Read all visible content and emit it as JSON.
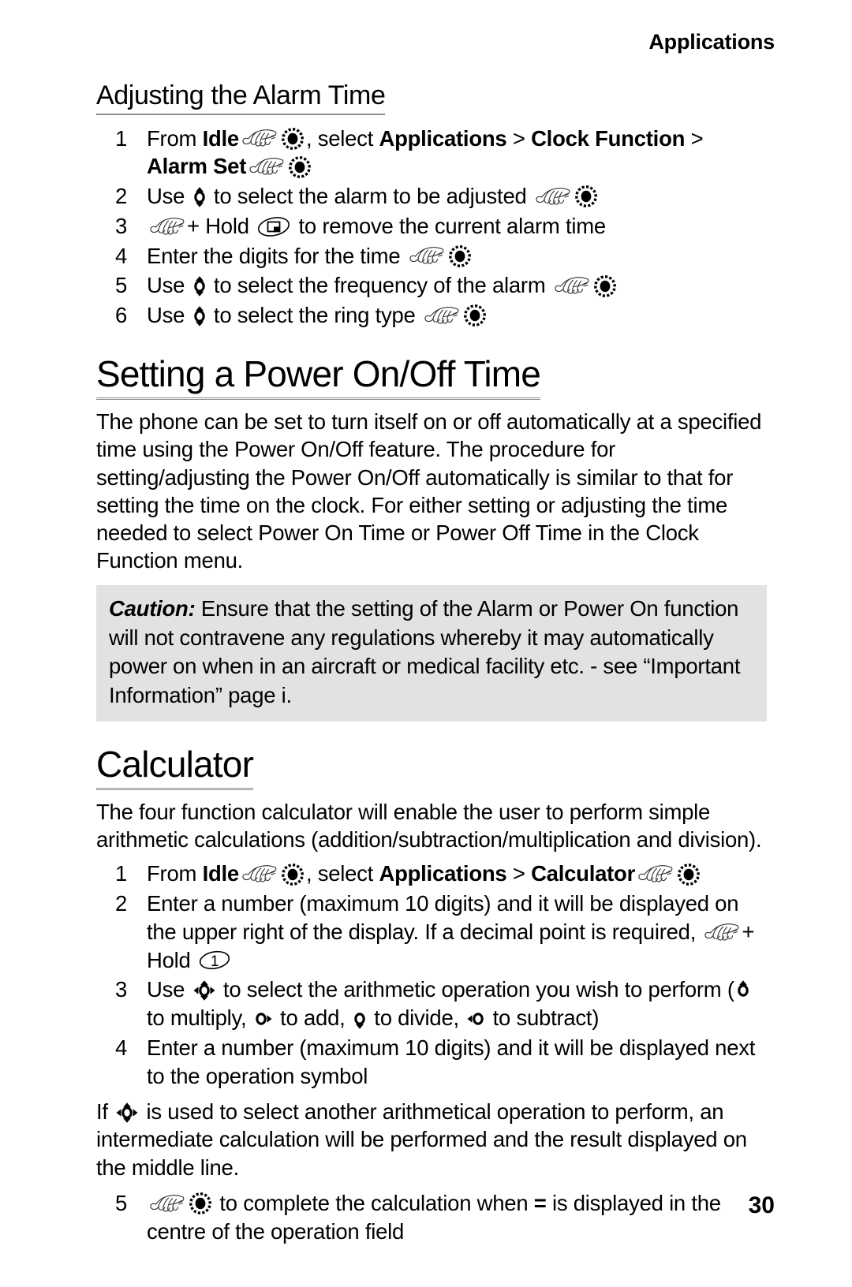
{
  "header": {
    "running_title": "Applications"
  },
  "page_number": "30",
  "colors": {
    "text": "#000000",
    "page_background": "#ffffff",
    "caution_background": "#e2e2e2",
    "heading_rule": "#8d8d8d"
  },
  "sections": [
    {
      "id": "adjusting-alarm-time",
      "heading": "Adjusting the Alarm Time",
      "heading_level": "sub",
      "steps": [
        {
          "number": "1",
          "parts": [
            {
              "type": "text",
              "value": "From "
            },
            {
              "type": "bold",
              "value": "Idle"
            },
            {
              "type": "icon",
              "name": "hand-press-icon"
            },
            {
              "type": "icon",
              "name": "select-key-icon"
            },
            {
              "type": "text",
              "value": ", select "
            },
            {
              "type": "bold",
              "value": "Applications"
            },
            {
              "type": "text",
              "value": " > "
            },
            {
              "type": "bold",
              "value": "Clock Function"
            },
            {
              "type": "text",
              "value": " > "
            },
            {
              "type": "bold",
              "value": "Alarm Set"
            },
            {
              "type": "icon",
              "name": "hand-press-icon"
            },
            {
              "type": "icon",
              "name": "select-key-icon"
            }
          ]
        },
        {
          "number": "2",
          "parts": [
            {
              "type": "text",
              "value": "Use "
            },
            {
              "type": "icon",
              "name": "nav-up-down-icon"
            },
            {
              "type": "text",
              "value": " to select the alarm to be adjusted "
            },
            {
              "type": "icon",
              "name": "hand-press-icon"
            },
            {
              "type": "icon",
              "name": "select-key-icon"
            }
          ]
        },
        {
          "number": "3",
          "parts": [
            {
              "type": "icon",
              "name": "hand-press-icon"
            },
            {
              "type": "text",
              "value": "+ Hold "
            },
            {
              "type": "icon",
              "name": "clear-key-icon"
            },
            {
              "type": "text",
              "value": " to remove the current alarm time"
            }
          ]
        },
        {
          "number": "4",
          "parts": [
            {
              "type": "text",
              "value": "Enter the digits for the time "
            },
            {
              "type": "icon",
              "name": "hand-press-icon"
            },
            {
              "type": "icon",
              "name": "select-key-icon"
            }
          ]
        },
        {
          "number": "5",
          "parts": [
            {
              "type": "text",
              "value": "Use "
            },
            {
              "type": "icon",
              "name": "nav-up-down-icon"
            },
            {
              "type": "text",
              "value": " to select the frequency of the alarm "
            },
            {
              "type": "icon",
              "name": "hand-press-icon"
            },
            {
              "type": "icon",
              "name": "select-key-icon"
            }
          ]
        },
        {
          "number": "6",
          "parts": [
            {
              "type": "text",
              "value": "Use "
            },
            {
              "type": "icon",
              "name": "nav-up-down-icon"
            },
            {
              "type": "text",
              "value": " to select the ring type "
            },
            {
              "type": "icon",
              "name": "hand-press-icon"
            },
            {
              "type": "icon",
              "name": "select-key-icon"
            }
          ]
        }
      ]
    },
    {
      "id": "setting-power-on-off-time",
      "heading": "Setting a Power On/Off Time",
      "heading_level": "main",
      "paragraph": "The phone can be set to turn itself on or off automatically at a specified time using the Power On/Off feature. The procedure for setting/adjusting the Power On/Off automatically is similar to that for setting the time on the clock. For either setting or adjusting the time  needed to select Power On Time or Power Off Time in the Clock Function menu.",
      "caution": {
        "label": "Caution:",
        "text": " Ensure that the setting of the Alarm or Power On function will not contravene any regulations whereby it may automatically power on when in an aircraft or medical facility etc. - see “Important Information” page i."
      }
    },
    {
      "id": "calculator",
      "heading": "Calculator",
      "heading_level": "main",
      "paragraph": "The four function calculator will enable the user to perform simple arithmetic calculations (addition/subtraction/multiplication and division).",
      "steps": [
        {
          "number": "1",
          "parts": [
            {
              "type": "text",
              "value": "From "
            },
            {
              "type": "bold",
              "value": "Idle"
            },
            {
              "type": "icon",
              "name": "hand-press-icon"
            },
            {
              "type": "icon",
              "name": "select-key-icon"
            },
            {
              "type": "text",
              "value": ", select "
            },
            {
              "type": "bold",
              "value": "Applications"
            },
            {
              "type": "text",
              "value": " > "
            },
            {
              "type": "bold",
              "value": "Calculator"
            },
            {
              "type": "icon",
              "name": "hand-press-icon"
            },
            {
              "type": "icon",
              "name": "select-key-icon"
            }
          ]
        },
        {
          "number": "2",
          "parts": [
            {
              "type": "text",
              "value": "Enter a number (maximum 10 digits) and it will be displayed on the upper right of the display. If a decimal point is required, "
            },
            {
              "type": "icon",
              "name": "hand-press-icon"
            },
            {
              "type": "text",
              "value": "+ Hold "
            },
            {
              "type": "icon",
              "name": "key-one-icon"
            }
          ]
        },
        {
          "number": "3",
          "parts": [
            {
              "type": "text",
              "value": "Use "
            },
            {
              "type": "icon",
              "name": "nav-four-way-icon"
            },
            {
              "type": "text",
              "value": " to select the arithmetic operation you wish to perform ("
            },
            {
              "type": "icon",
              "name": "nav-up-icon"
            },
            {
              "type": "text",
              "value": " to multiply, "
            },
            {
              "type": "icon",
              "name": "nav-right-icon"
            },
            {
              "type": "text",
              "value": " to add, "
            },
            {
              "type": "icon",
              "name": "nav-down-icon"
            },
            {
              "type": "text",
              "value": " to divide, "
            },
            {
              "type": "icon",
              "name": "nav-left-icon"
            },
            {
              "type": "text",
              "value": " to subtract)"
            }
          ]
        },
        {
          "number": "4",
          "parts": [
            {
              "type": "text",
              "value": "Enter a number (maximum 10 digits) and it will be displayed next to the operation symbol"
            }
          ]
        }
      ],
      "note_parts": [
        {
          "type": "text",
          "value": "If "
        },
        {
          "type": "icon",
          "name": "nav-four-way-icon"
        },
        {
          "type": "text",
          "value": " is used to select another arithmetical operation to perform, an intermediate calculation will be performed and the result displayed on the middle line."
        }
      ],
      "final_step": {
        "number": "5",
        "parts": [
          {
            "type": "icon",
            "name": "hand-press-icon"
          },
          {
            "type": "icon",
            "name": "select-key-icon"
          },
          {
            "type": "text",
            "value": " to complete the calculation when "
          },
          {
            "type": "bold",
            "value": "="
          },
          {
            "type": "text",
            "value": " is displayed in the centre of the operation field"
          }
        ]
      }
    }
  ]
}
